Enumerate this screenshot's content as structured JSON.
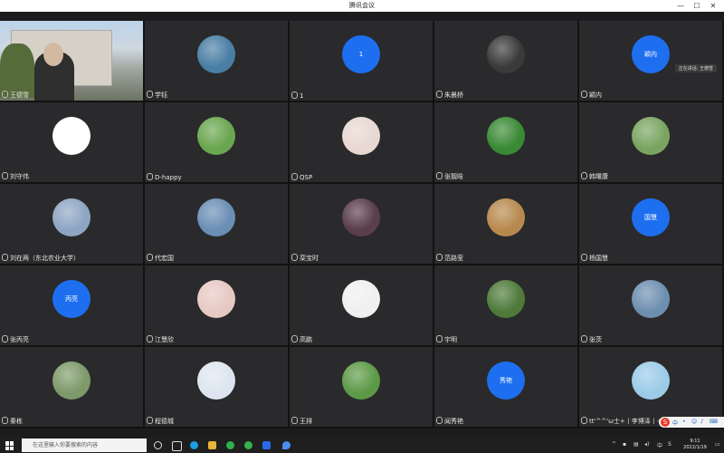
{
  "window": {
    "title": "腾讯会议",
    "min_label": "—",
    "max_label": "☐",
    "close_label": "✕"
  },
  "participants": [
    {
      "name": "王德雪",
      "avatar": "video"
    },
    {
      "name": "学钰",
      "avatar": "anime-girl",
      "bg": "#4a7fa5"
    },
    {
      "name": "1",
      "avatar": "text",
      "avatar_text": "1"
    },
    {
      "name": "朱晨桥",
      "avatar": "dark-portrait",
      "bg": "#3a3a3a"
    },
    {
      "name": "颖内",
      "avatar": "text",
      "avatar_text": "颖内"
    },
    {
      "name": "刘守伟",
      "avatar": "cartoon",
      "bg": "#ffffff"
    },
    {
      "name": "D-happy",
      "avatar": "green-scene",
      "bg": "#6aa64f"
    },
    {
      "name": "QSP",
      "avatar": "cartoon-girl",
      "bg": "#e8d8d2"
    },
    {
      "name": "张靓晗",
      "avatar": "sunflower",
      "bg": "#3a8a35"
    },
    {
      "name": "韩曙康",
      "avatar": "field",
      "bg": "#7aa561"
    },
    {
      "name": "刘在两（东北农业大学）",
      "avatar": "person-outdoor",
      "bg": "#8ea6c4"
    },
    {
      "name": "代宏国",
      "avatar": "sunflower-2",
      "bg": "#6b8eb5"
    },
    {
      "name": "栾宝时",
      "avatar": "purple-flower",
      "bg": "#5a3e4a"
    },
    {
      "name": "范路莹",
      "avatar": "portrait-warm",
      "bg": "#b8894e"
    },
    {
      "name": "杨国慧",
      "avatar": "text",
      "avatar_text": "国慧"
    },
    {
      "name": "张丙亮",
      "avatar": "text",
      "avatar_text": "丙亮"
    },
    {
      "name": "江慧欣",
      "avatar": "baby",
      "bg": "#e7c9c4"
    },
    {
      "name": "高鹏",
      "avatar": "boss-baby",
      "bg": "#f0f0f0"
    },
    {
      "name": "宇明",
      "avatar": "plants",
      "bg": "#4f7a3a"
    },
    {
      "name": "张茨",
      "avatar": "palace",
      "bg": "#6f8fb0"
    },
    {
      "name": "秦栋",
      "avatar": "couple-field",
      "bg": "#7e9a6b"
    },
    {
      "name": "程德城",
      "avatar": "white-toy",
      "bg": "#dde6f0"
    },
    {
      "name": "王排",
      "avatar": "cabbage",
      "bg": "#5d9a47"
    },
    {
      "name": "闻秀艳",
      "avatar": "text",
      "avatar_text": "秀艳"
    },
    {
      "name": "tt'^^'ω士+丨李博泽丨+七",
      "avatar": "dandelion",
      "bg": "#9ccbe8"
    }
  ],
  "speaking": {
    "label": "正在讲话: 王德雪"
  },
  "taskbar": {
    "search_placeholder": "在这里输入你要搜索的内容",
    "time": "9:11",
    "date": "2022/1/19",
    "ime_label": "中"
  }
}
